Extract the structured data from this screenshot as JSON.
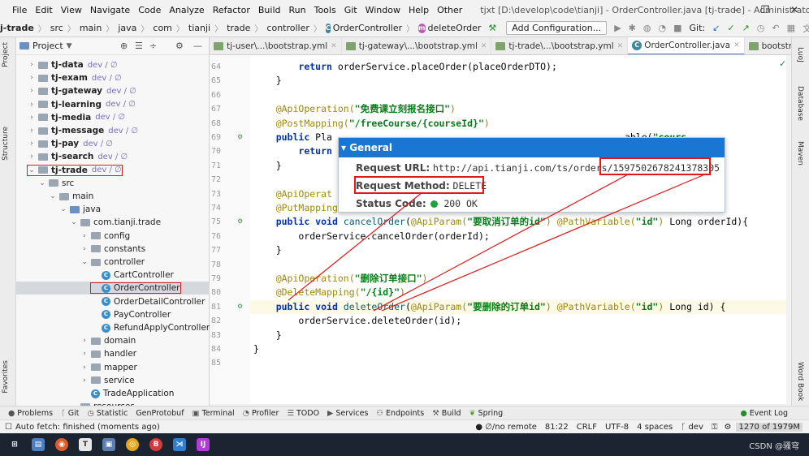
{
  "menu": [
    "File",
    "Edit",
    "View",
    "Navigate",
    "Code",
    "Analyze",
    "Refactor",
    "Build",
    "Run",
    "Tools",
    "Git",
    "Window",
    "Help",
    "Other"
  ],
  "window_title": "tjxt [D:\\develop\\code\\tianji] - OrderController.java [tj-trade] - Administrator",
  "window_controls": {
    "minimize": "–",
    "restore": "❐",
    "close": "✕"
  },
  "breadcrumb": [
    "j-trade",
    "src",
    "main",
    "java",
    "com",
    "tianji",
    "trade",
    "controller",
    "OrderController",
    "deleteOrder"
  ],
  "toolbar": {
    "add_config": "Add Configuration...",
    "git_label": "Git:"
  },
  "left_stripe": {
    "project": "Project",
    "structure": "Structure",
    "favorites": "Favorites"
  },
  "project_panel": {
    "title": "Project",
    "tree": [
      {
        "label": "tj-data",
        "branch": "dev / ∅",
        "level": 1,
        "arrow": ">",
        "icon": "module",
        "sel": false,
        "hl": false
      },
      {
        "label": "tj-exam",
        "branch": "dev / ∅",
        "level": 1,
        "arrow": ">",
        "icon": "module",
        "sel": false,
        "hl": false
      },
      {
        "label": "tj-gateway",
        "branch": "dev / ∅",
        "level": 1,
        "arrow": ">",
        "icon": "module",
        "sel": false,
        "hl": false
      },
      {
        "label": "tj-learning",
        "branch": "dev / ∅",
        "level": 1,
        "arrow": ">",
        "icon": "module",
        "sel": false,
        "hl": false
      },
      {
        "label": "tj-media",
        "branch": "dev / ∅",
        "level": 1,
        "arrow": ">",
        "icon": "module",
        "sel": false,
        "hl": false
      },
      {
        "label": "tj-message",
        "branch": "dev / ∅",
        "level": 1,
        "arrow": ">",
        "icon": "module",
        "sel": false,
        "hl": false
      },
      {
        "label": "tj-pay",
        "branch": "dev / ∅",
        "level": 1,
        "arrow": ">",
        "icon": "module",
        "sel": false,
        "hl": false
      },
      {
        "label": "tj-search",
        "branch": "dev / ∅",
        "level": 1,
        "arrow": ">",
        "icon": "module",
        "sel": false,
        "hl": false
      },
      {
        "label": "tj-trade",
        "branch": "dev / ∅",
        "level": 1,
        "arrow": "v",
        "icon": "module",
        "sel": false,
        "hl": true
      },
      {
        "label": "src",
        "branch": "",
        "level": 2,
        "arrow": "v",
        "icon": "folder",
        "sel": false,
        "hl": false
      },
      {
        "label": "main",
        "branch": "",
        "level": 3,
        "arrow": "v",
        "icon": "folder",
        "sel": false,
        "hl": false
      },
      {
        "label": "java",
        "branch": "",
        "level": 4,
        "arrow": "v",
        "icon": "folder-blue",
        "sel": false,
        "hl": false
      },
      {
        "label": "com.tianji.trade",
        "branch": "",
        "level": 5,
        "arrow": "v",
        "icon": "folder",
        "sel": false,
        "hl": false
      },
      {
        "label": "config",
        "branch": "",
        "level": 6,
        "arrow": ">",
        "icon": "folder",
        "sel": false,
        "hl": false
      },
      {
        "label": "constants",
        "branch": "",
        "level": 6,
        "arrow": ">",
        "icon": "folder",
        "sel": false,
        "hl": false
      },
      {
        "label": "controller",
        "branch": "",
        "level": 6,
        "arrow": "v",
        "icon": "folder",
        "sel": false,
        "hl": false
      },
      {
        "label": "CartController",
        "branch": "",
        "level": 7,
        "arrow": "",
        "icon": "class",
        "sel": false,
        "hl": false
      },
      {
        "label": "OrderController",
        "branch": "",
        "level": 7,
        "arrow": "",
        "icon": "class",
        "sel": true,
        "hl": true
      },
      {
        "label": "OrderDetailController",
        "branch": "",
        "level": 7,
        "arrow": "",
        "icon": "class",
        "sel": false,
        "hl": false
      },
      {
        "label": "PayController",
        "branch": "",
        "level": 7,
        "arrow": "",
        "icon": "class",
        "sel": false,
        "hl": false
      },
      {
        "label": "RefundApplyController",
        "branch": "",
        "level": 7,
        "arrow": "",
        "icon": "class",
        "sel": false,
        "hl": false
      },
      {
        "label": "domain",
        "branch": "",
        "level": 6,
        "arrow": ">",
        "icon": "folder",
        "sel": false,
        "hl": false
      },
      {
        "label": "handler",
        "branch": "",
        "level": 6,
        "arrow": ">",
        "icon": "folder",
        "sel": false,
        "hl": false
      },
      {
        "label": "mapper",
        "branch": "",
        "level": 6,
        "arrow": ">",
        "icon": "folder",
        "sel": false,
        "hl": false
      },
      {
        "label": "service",
        "branch": "",
        "level": 6,
        "arrow": ">",
        "icon": "folder",
        "sel": false,
        "hl": false
      },
      {
        "label": "TradeApplication",
        "branch": "",
        "level": 6,
        "arrow": "",
        "icon": "class",
        "sel": false,
        "hl": false
      },
      {
        "label": "resources",
        "branch": "",
        "level": 5,
        "arrow": "v",
        "icon": "folder",
        "sel": false,
        "hl": false
      }
    ]
  },
  "editor_tabs": [
    {
      "label": "tj-user\\...\\bootstrap.yml",
      "active": false
    },
    {
      "label": "tj-gateway\\...\\bootstrap.yml",
      "active": false
    },
    {
      "label": "tj-trade\\...\\bootstrap.yml",
      "active": false
    },
    {
      "label": "OrderController.java",
      "active": true
    },
    {
      "label": "bootstrap-dev.yml",
      "active": false
    }
  ],
  "code_lines": [
    {
      "n": "64",
      "gm": "",
      "segs": [
        [
          "",
          "        "
        ],
        [
          "kw",
          "return "
        ],
        [
          "",
          "orderService.placeOrder(placeOrderDTO);"
        ]
      ]
    },
    {
      "n": "65",
      "gm": "",
      "segs": [
        [
          "",
          "    }"
        ]
      ]
    },
    {
      "n": "66",
      "gm": "",
      "segs": [
        [
          "",
          ""
        ]
      ]
    },
    {
      "n": "67",
      "gm": "",
      "segs": [
        [
          "",
          "    "
        ],
        [
          "an",
          "@ApiOperation("
        ],
        [
          "st",
          "\"免费课立刻报名接口\""
        ],
        [
          "an",
          ")"
        ]
      ]
    },
    {
      "n": "68",
      "gm": "",
      "segs": [
        [
          "",
          "    "
        ],
        [
          "an",
          "@PostMapping("
        ],
        [
          "st",
          "\"/freeCourse/{courseId}\""
        ],
        [
          "an",
          ")"
        ]
      ]
    },
    {
      "n": "69",
      "gm": "⚙",
      "segs": [
        [
          "",
          "    "
        ],
        [
          "kw",
          "public "
        ],
        [
          "",
          "Pla                                                    able("
        ],
        [
          "st",
          "\"cours"
        ]
      ]
    },
    {
      "n": "70",
      "gm": "",
      "segs": [
        [
          "",
          "        "
        ],
        [
          "kw",
          "return"
        ]
      ]
    },
    {
      "n": "71",
      "gm": "",
      "segs": [
        [
          "",
          "    }"
        ]
      ]
    },
    {
      "n": "72",
      "gm": "",
      "segs": [
        [
          "",
          ""
        ]
      ]
    },
    {
      "n": "73",
      "gm": "",
      "segs": [
        [
          "",
          "    "
        ],
        [
          "an",
          "@ApiOperat"
        ]
      ]
    },
    {
      "n": "74",
      "gm": "",
      "segs": [
        [
          "",
          "    "
        ],
        [
          "an",
          "@PutMapping("
        ],
        [
          "st",
          "\"/{id}/cancel\""
        ],
        [
          "an",
          ")"
        ]
      ]
    },
    {
      "n": "75",
      "gm": "⚙",
      "segs": [
        [
          "",
          "    "
        ],
        [
          "kw",
          "public void "
        ],
        [
          "mt",
          "cancelOrder"
        ],
        [
          "",
          "("
        ],
        [
          "an",
          "@ApiParam("
        ],
        [
          "st",
          "\"要取消订单的id\""
        ],
        [
          "an",
          ") @PathVariable("
        ],
        [
          "st",
          "\"id\""
        ],
        [
          "an",
          ") "
        ],
        [
          "",
          "Long orderId){"
        ]
      ]
    },
    {
      "n": "76",
      "gm": "",
      "segs": [
        [
          "",
          "        orderService.cancelOrder(orderId);"
        ]
      ]
    },
    {
      "n": "77",
      "gm": "",
      "segs": [
        [
          "",
          "    }"
        ]
      ]
    },
    {
      "n": "78",
      "gm": "",
      "segs": [
        [
          "",
          ""
        ]
      ]
    },
    {
      "n": "79",
      "gm": "",
      "segs": [
        [
          "",
          "    "
        ],
        [
          "an",
          "@ApiOperation("
        ],
        [
          "st",
          "\"删除订单接口\""
        ],
        [
          "an",
          ")"
        ]
      ]
    },
    {
      "n": "80",
      "gm": "",
      "segs": [
        [
          "",
          "    "
        ],
        [
          "an",
          "@DeleteMapping("
        ],
        [
          "st",
          "\"/{id}\""
        ],
        [
          "an",
          ")"
        ]
      ]
    },
    {
      "n": "81",
      "gm": "⚙",
      "segs": [
        [
          "",
          "    "
        ],
        [
          "kw",
          "public void "
        ],
        [
          "mt",
          "deleteOrder"
        ],
        [
          "",
          "("
        ],
        [
          "an",
          "@ApiParam("
        ],
        [
          "st",
          "\"要删除的订单id\""
        ],
        [
          "an",
          ") @PathVariable("
        ],
        [
          "st",
          "\"id\""
        ],
        [
          "an",
          ") "
        ],
        [
          "",
          "Long id) {"
        ]
      ]
    },
    {
      "n": "82",
      "gm": "",
      "segs": [
        [
          "",
          "        orderService.deleteOrder(id);"
        ]
      ]
    },
    {
      "n": "83",
      "gm": "",
      "segs": [
        [
          "",
          "    }"
        ]
      ]
    },
    {
      "n": "84",
      "gm": "",
      "segs": [
        [
          "",
          "}"
        ]
      ]
    },
    {
      "n": "85",
      "gm": "",
      "segs": [
        [
          "",
          ""
        ]
      ]
    }
  ],
  "popup": {
    "header": "▾ General",
    "url_label": "Request URL:",
    "url_value": "http://api.tianji.com/ts/orders/",
    "url_id": "1597502678241378305",
    "method_label": "Request Method:",
    "method_value": "DELETE",
    "status_label": "Status Code:",
    "status_value": "200 OK"
  },
  "right_stripe": {
    "db": "Database",
    "maven": "Maven",
    "word": "Word Book",
    "luo": "LuoJ"
  },
  "bottom_tools": [
    "Problems",
    "Git",
    "Statistic",
    "GenProtobuf",
    "Terminal",
    "Profiler",
    "TODO",
    "Services",
    "Endpoints",
    "Build",
    "Spring"
  ],
  "event_log": "Event Log",
  "status": {
    "left": "Auto fetch: finished (moments ago)",
    "remote": "∅/no remote",
    "pos": "81:22",
    "crlf": "CRLF",
    "enc": "UTF-8",
    "indent": "4 spaces",
    "branch": "dev",
    "mem": "1270 of 1979M"
  },
  "watermark": "CSDN @骚穹",
  "colors": {
    "accent": "#1976d2",
    "highlight_box": "#e01818"
  }
}
